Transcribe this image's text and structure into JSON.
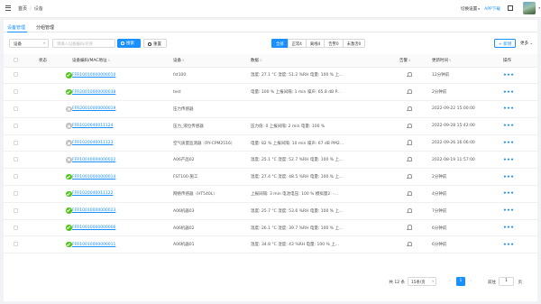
{
  "header": {
    "breadcrumb": [
      "首页",
      "设备"
    ],
    "org_switch": "切换设置",
    "app_download": "APP下载"
  },
  "tabs": [
    "设备管理",
    "分组管理"
  ],
  "toolbar": {
    "type_select": "设备",
    "search_placeholder": "请输入设备编码/名称",
    "query_label": "搜索",
    "reset_label": "重置",
    "filters": [
      "全部",
      "正常4",
      "离线4",
      "告警0",
      "未激活0"
    ],
    "add_label": "+ 新增",
    "more_label": "更多 ⌄"
  },
  "table": {
    "columns": [
      "状态",
      "设备编码/MAC地址",
      "设备",
      "数据",
      "告警",
      "更新时间",
      "操作"
    ],
    "rows": [
      {
        "status": "on",
        "code": "FFR10010000000010",
        "device": "fst100",
        "data": "温度:  27.1 °C     湿度:  51.2 %RH     电量:  100 %     上...",
        "time": "12分钟前"
      },
      {
        "status": "on",
        "code": "FFR20010000000038",
        "device": "test",
        "data": "电量:  100 %     上报间隔:  1 min     噪声:  65.8 dB     P...",
        "time": "2分钟前"
      },
      {
        "status": "off",
        "code": "FFR20010000000019",
        "device": "压力传感器",
        "data": "",
        "time": "2022-09-22 15:00:00"
      },
      {
        "status": "off",
        "code": "FFR1020040011124",
        "device": "压力_液位传感器",
        "data": "压力值:  0     上报间隔:  2 min     电量:  100 %",
        "time": "2022-09-28 15:42:00"
      },
      {
        "status": "off",
        "code": "FFR1020040011123",
        "device": "空气质量监测器（RY-CPM2516）",
        "data": "电量:  82 %     上报间隔:  10 min     噪声:  67 dB     PM2...",
        "time": "2022-09-26 16:06:00"
      },
      {
        "status": "off",
        "code": "FFR10010000000022",
        "device": "A06产品02",
        "data": "温度:  25.1 °C     湿度:  52.7 %RH     电量:  100 %     上...",
        "time": "2022-08-19 11:57:00"
      },
      {
        "status": "on",
        "code": "FFR10010000000014",
        "device": "FST100-施工",
        "data": "温度:  27.4 °C     湿度:  48.5 %RH     电量:  100 %     上...",
        "time": "2分钟前"
      },
      {
        "status": "on",
        "code": "FFR1020040011122",
        "device": "网络传感器（HT540L）",
        "data": "上报间隔:  3 min     电池电压:  100 %     模拟量2:  -...",
        "time": "4分钟前"
      },
      {
        "status": "on",
        "code": "FFR10010000000023",
        "device": "A06机器03",
        "data": "温度:  25.7 °C     湿度:  53.6 %RH     电量:  100 %     上...",
        "time": "7分钟前"
      },
      {
        "status": "on",
        "code": "FFR10010000000006",
        "device": "A06机器02",
        "data": "温度:  26.1 °C     湿度:  39.7 %RH     电量:  100 %     上...",
        "time": "6分钟前"
      },
      {
        "status": "on",
        "code": "FFR10010000000011",
        "device": "A06机器01",
        "data": "温度:  34.8 °C     湿度:  43 %RH     电量:  100 %     上...",
        "time": "6分钟前"
      }
    ]
  },
  "pagination": {
    "total": "共 12 条",
    "page_size": "15条/页",
    "prev": "‹",
    "current": "1",
    "next": "›",
    "jump_label": "前往",
    "jump_value": "1",
    "jump_unit": "页"
  },
  "colors": {
    "primary": "#1890ff",
    "online": "#52c41a",
    "offline": "#bfbfbf"
  }
}
